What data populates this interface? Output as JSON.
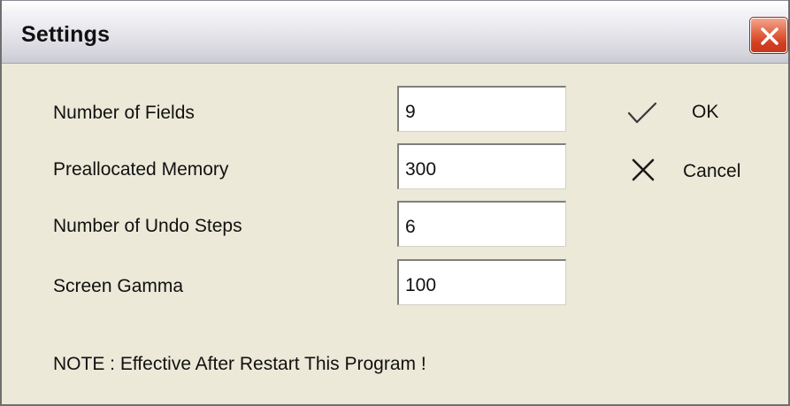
{
  "window": {
    "title": "Settings"
  },
  "fields": [
    {
      "label": "Number of Fields",
      "value": "9"
    },
    {
      "label": "Preallocated Memory",
      "value": "300"
    },
    {
      "label": "Number of Undo Steps",
      "value": "6"
    },
    {
      "label": "Screen Gamma",
      "value": "100"
    }
  ],
  "buttons": {
    "ok_label": "OK",
    "ok_icon": "checkmark-icon",
    "cancel_label": "Cancel",
    "cancel_icon": "x-icon"
  },
  "note": "NOTE : Effective After Restart This Program !",
  "colors": {
    "dialog_bg": "#ece9d8",
    "close_button": "#d23d20",
    "field_bg": "#ffffff"
  }
}
